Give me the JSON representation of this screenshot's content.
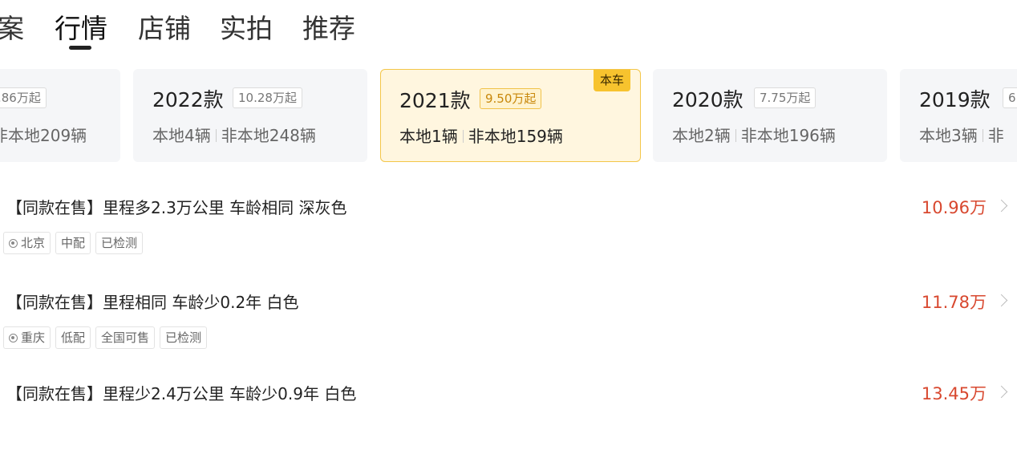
{
  "tabs": [
    {
      "label": "案"
    },
    {
      "label": "行情"
    },
    {
      "label": "店铺"
    },
    {
      "label": "实拍"
    },
    {
      "label": "推荐"
    }
  ],
  "year_cards": [
    {
      "year": "",
      "price": ".86万起",
      "local": "",
      "nonlocal": "非本地209辆"
    },
    {
      "year": "2022款",
      "price": "10.28万起",
      "local": "本地4辆",
      "nonlocal": "非本地248辆"
    },
    {
      "year": "2021款",
      "price": "9.50万起",
      "local": "本地1辆",
      "nonlocal": "非本地159辆",
      "badge": "本车"
    },
    {
      "year": "2020款",
      "price": "7.75万起",
      "local": "本地2辆",
      "nonlocal": "非本地196辆"
    },
    {
      "year": "2019款",
      "price": "6",
      "local": "本地3辆",
      "nonlocal": "非"
    }
  ],
  "listings": [
    {
      "title": "【同款在售】里程多2.3万公里 车龄相同 深灰色",
      "price": "10.96万",
      "tags": [
        "北京",
        "中配",
        "已检测"
      ]
    },
    {
      "title": "【同款在售】里程相同 车龄少0.2年 白色",
      "price": "11.78万",
      "tags": [
        "重庆",
        "低配",
        "全国可售",
        "已检测"
      ]
    },
    {
      "title": "【同款在售】里程少2.4万公里 车龄少0.9年 白色",
      "price": "13.45万",
      "tags": []
    }
  ],
  "colors": {
    "accent_price": "#d8482f",
    "selected_card_bg": "#fff6df",
    "badge_bg": "#f7c32e"
  },
  "icons": {
    "location": "location-pin-icon",
    "chevron": "chevron-right-icon"
  }
}
